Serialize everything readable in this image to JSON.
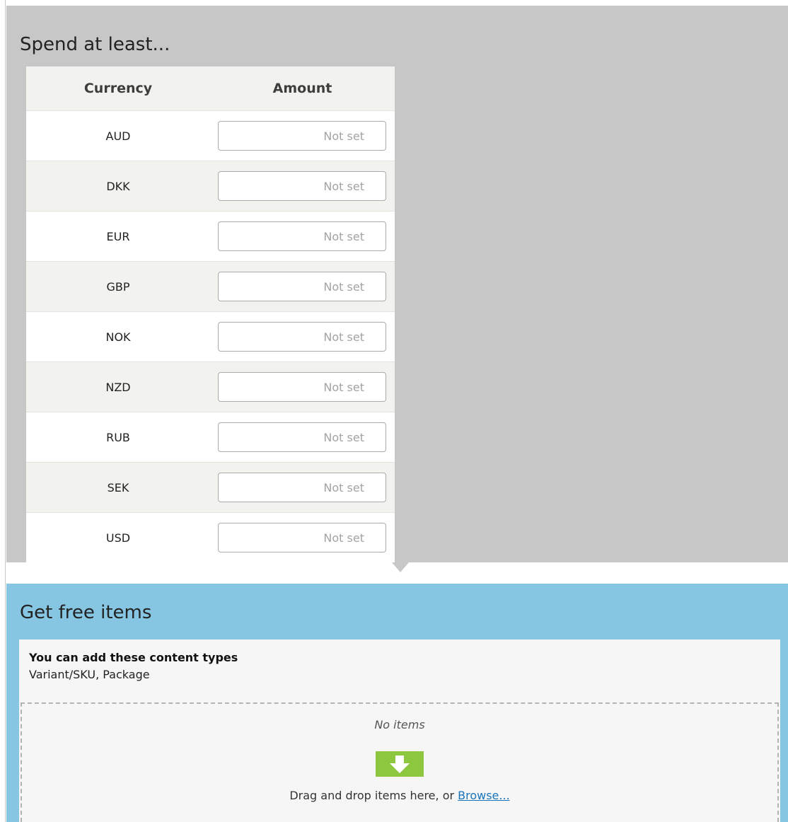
{
  "spend_section": {
    "title": "Spend at least...",
    "columns": {
      "currency": "Currency",
      "amount": "Amount"
    },
    "rows": [
      {
        "currency": "AUD",
        "amount": "",
        "placeholder": "Not set"
      },
      {
        "currency": "DKK",
        "amount": "",
        "placeholder": "Not set"
      },
      {
        "currency": "EUR",
        "amount": "",
        "placeholder": "Not set"
      },
      {
        "currency": "GBP",
        "amount": "",
        "placeholder": "Not set"
      },
      {
        "currency": "NOK",
        "amount": "",
        "placeholder": "Not set"
      },
      {
        "currency": "NZD",
        "amount": "",
        "placeholder": "Not set"
      },
      {
        "currency": "RUB",
        "amount": "",
        "placeholder": "Not set"
      },
      {
        "currency": "SEK",
        "amount": "",
        "placeholder": "Not set"
      },
      {
        "currency": "USD",
        "amount": "",
        "placeholder": "Not set"
      }
    ],
    "background_color": "#c6c7c6"
  },
  "free_items_section": {
    "title": "Get free items",
    "content_types_heading": "You can add these content types",
    "content_types": "Variant/SKU, Package",
    "drop_zone": {
      "empty_text": "No items",
      "icon": "drop-arrow-icon",
      "instruction": "Drag and drop items here, or ",
      "browse_label": "Browse..."
    },
    "background_color": "#86c6e2",
    "icon_color": "#8dc63f"
  }
}
